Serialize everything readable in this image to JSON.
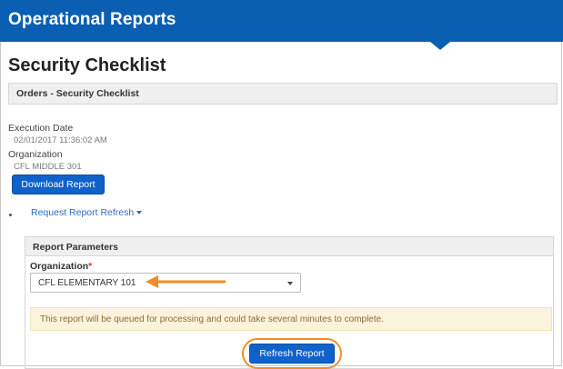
{
  "app": {
    "title": "Operational Reports"
  },
  "page": {
    "title": "Security Checklist"
  },
  "panel": {
    "heading": "Orders - Security Checklist"
  },
  "details": {
    "execution_date_label": "Execution Date",
    "execution_date_value": "02/01/2017 11:36:02 AM",
    "organization_label": "Organization",
    "organization_value": "CFL MIDDLE 301"
  },
  "actions": {
    "download_label": "Download Report",
    "request_refresh_label": "Request Report Refresh"
  },
  "parameters": {
    "heading": "Report Parameters",
    "organization_label": "Organization",
    "required_marker": "*",
    "organization_selected": "CFL ELEMENTARY 101",
    "notice": "This report will be queued for processing and could take several minutes to complete.",
    "refresh_label": "Refresh Report"
  },
  "colors": {
    "header_blue": "#0b5fb3",
    "button_blue": "#0f62c9",
    "annotation_orange": "#f28c28",
    "notice_bg": "#fcf3dc"
  }
}
